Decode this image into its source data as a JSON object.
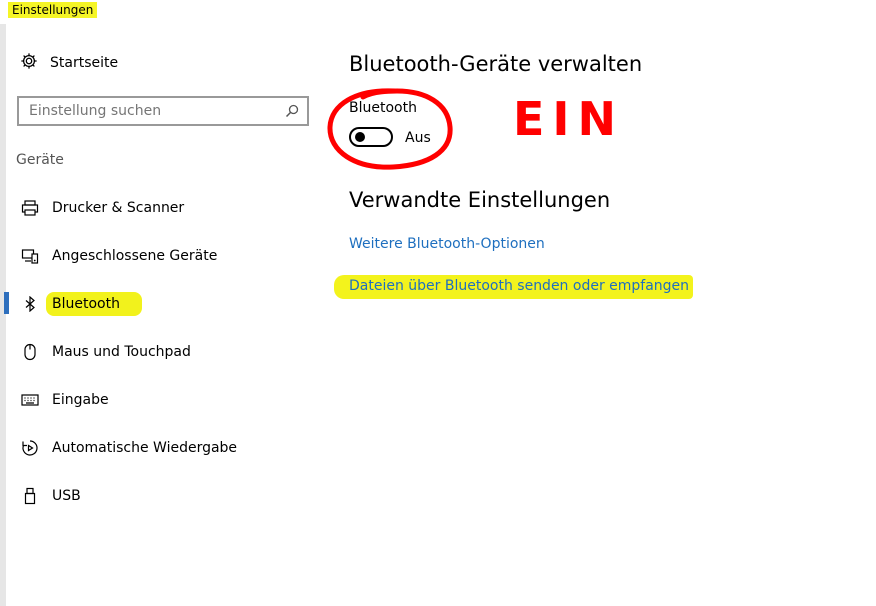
{
  "window": {
    "title": "Einstellungen"
  },
  "sidebar": {
    "home_label": "Startseite",
    "search": {
      "placeholder": "Einstellung suchen"
    },
    "section": "Geräte",
    "items": [
      {
        "label": "Drucker & Scanner",
        "icon": "printer-icon"
      },
      {
        "label": "Angeschlossene Geräte",
        "icon": "devices-icon"
      },
      {
        "label": "Bluetooth",
        "icon": "bluetooth-icon",
        "active": true
      },
      {
        "label": "Maus und Touchpad",
        "icon": "mouse-icon"
      },
      {
        "label": "Eingabe",
        "icon": "keyboard-icon"
      },
      {
        "label": "Automatische Wiedergabe",
        "icon": "autoplay-icon"
      },
      {
        "label": "USB",
        "icon": "usb-icon"
      }
    ]
  },
  "main": {
    "title": "Bluetooth-Geräte verwalten",
    "bluetooth_label": "Bluetooth",
    "toggle_state": "Aus",
    "related_title": "Verwandte Einstellungen",
    "links": [
      "Weitere Bluetooth-Optionen",
      "Dateien über Bluetooth senden oder empfangen"
    ],
    "annotation": "EIN"
  },
  "colors": {
    "accent": "#2e6fbd",
    "link": "#1e6fbf",
    "highlight": "#f3f31c",
    "annotation": "#ff0000"
  }
}
